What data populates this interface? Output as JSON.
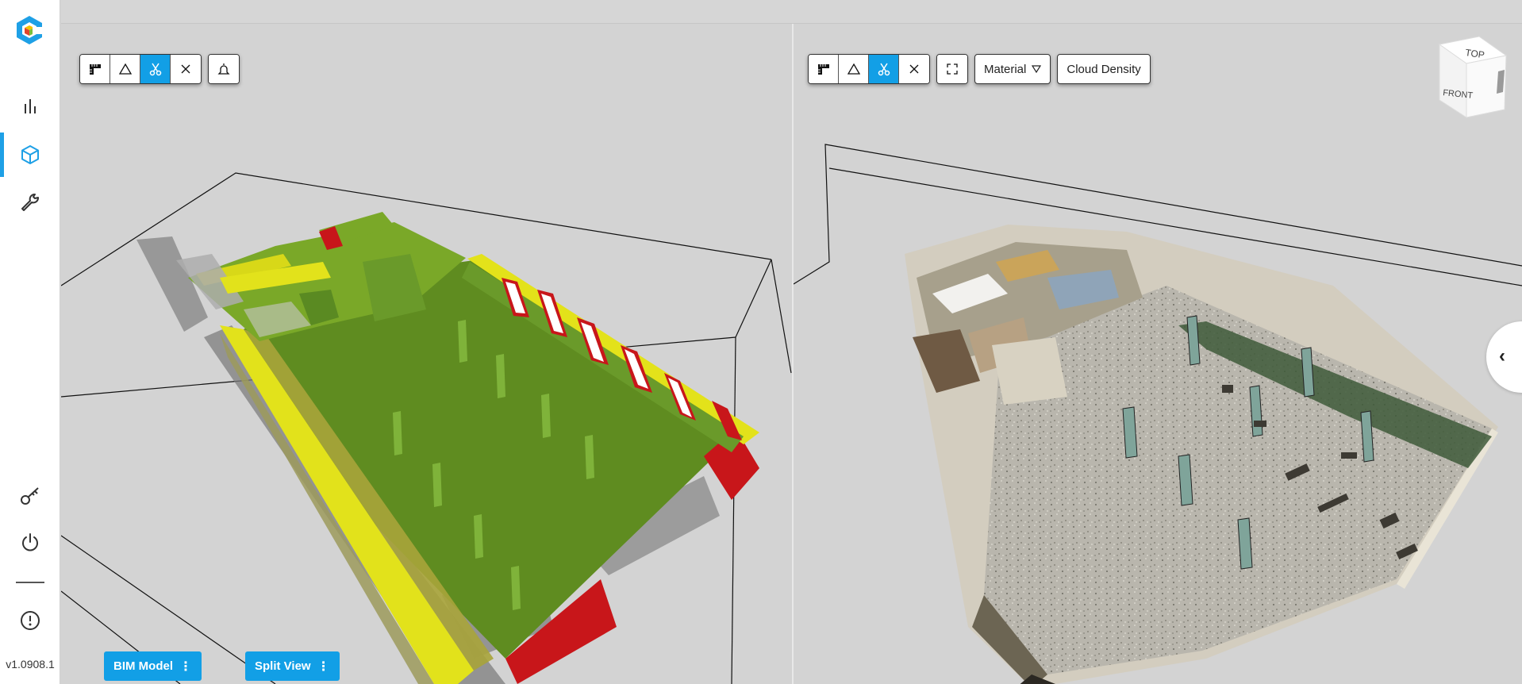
{
  "app": {
    "version": "v1.0908.1"
  },
  "sidebar": {
    "items": [
      {
        "icon": "bar-chart-icon",
        "active": false
      },
      {
        "icon": "cube-icon",
        "active": true
      },
      {
        "icon": "wrench-icon",
        "active": false
      },
      {
        "icon": "key-icon",
        "active": false
      },
      {
        "icon": "power-icon",
        "active": false
      },
      {
        "icon": "info-icon",
        "active": false
      }
    ]
  },
  "left_view": {
    "tools": [
      "ruler-icon",
      "triangle-icon",
      "scissors-icon",
      "close-icon"
    ],
    "extra_tool": "bell-icon",
    "model_button": "BIM Model",
    "split_button": "Split View"
  },
  "right_view": {
    "tools": [
      "ruler-icon",
      "triangle-icon",
      "scissors-icon",
      "close-icon"
    ],
    "fullscreen_tool": "expand-icon",
    "material_label": "Material",
    "cloud_density_label": "Cloud Density",
    "viewcube": {
      "top": "TOP",
      "front": "FRONT"
    }
  },
  "colors": {
    "accent": "#129fe6",
    "bim_green": "#6b9a2a",
    "bim_yellow": "#e3e21a",
    "bim_red": "#c8161a"
  }
}
